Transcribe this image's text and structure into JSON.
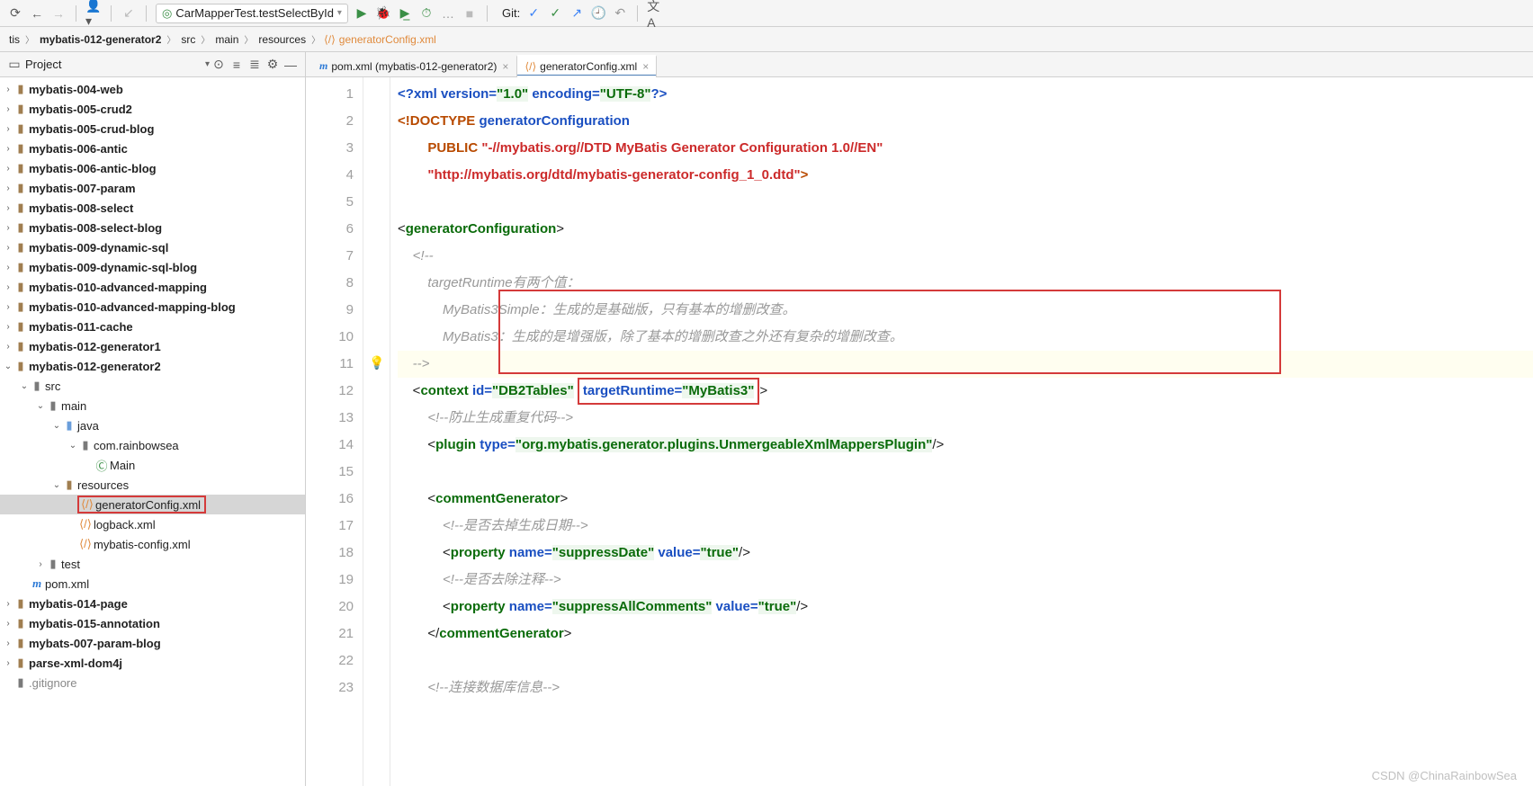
{
  "toolbar": {
    "run_config": "CarMapperTest.testSelectById",
    "git_label": "Git:"
  },
  "breadcrumb": {
    "items": [
      "tis",
      "mybatis-012-generator2",
      "src",
      "main",
      "resources"
    ],
    "file": "generatorConfig.xml"
  },
  "project": {
    "title": "Project",
    "tree": [
      {
        "d": 0,
        "c": "closed",
        "i": "folder",
        "t": "mybatis-004-web"
      },
      {
        "d": 0,
        "c": "closed",
        "i": "folder",
        "t": "mybatis-005-crud2"
      },
      {
        "d": 0,
        "c": "closed",
        "i": "folder",
        "t": "mybatis-005-crud-blog"
      },
      {
        "d": 0,
        "c": "closed",
        "i": "folder",
        "t": "mybatis-006-antic"
      },
      {
        "d": 0,
        "c": "closed",
        "i": "folder",
        "t": "mybatis-006-antic-blog"
      },
      {
        "d": 0,
        "c": "closed",
        "i": "folder",
        "t": "mybatis-007-param"
      },
      {
        "d": 0,
        "c": "closed",
        "i": "folder",
        "t": "mybatis-008-select"
      },
      {
        "d": 0,
        "c": "closed",
        "i": "folder",
        "t": "mybatis-008-select-blog"
      },
      {
        "d": 0,
        "c": "closed",
        "i": "folder",
        "t": "mybatis-009-dynamic-sql"
      },
      {
        "d": 0,
        "c": "closed",
        "i": "folder",
        "t": "mybatis-009-dynamic-sql-blog"
      },
      {
        "d": 0,
        "c": "closed",
        "i": "folder",
        "t": "mybatis-010-advanced-mapping"
      },
      {
        "d": 0,
        "c": "closed",
        "i": "folder",
        "t": "mybatis-010-advanced-mapping-blog"
      },
      {
        "d": 0,
        "c": "closed",
        "i": "folder",
        "t": "mybatis-011-cache"
      },
      {
        "d": 0,
        "c": "closed",
        "i": "folder",
        "t": "mybatis-012-generator1"
      },
      {
        "d": 0,
        "c": "open",
        "i": "folder",
        "t": "mybatis-012-generator2"
      },
      {
        "d": 1,
        "c": "open",
        "i": "folder-dark",
        "t": "src",
        "norm": true
      },
      {
        "d": 2,
        "c": "open",
        "i": "folder-dark",
        "t": "main",
        "norm": true
      },
      {
        "d": 3,
        "c": "open",
        "i": "folder-blue",
        "t": "java",
        "norm": true
      },
      {
        "d": 4,
        "c": "open",
        "i": "folder-dark",
        "t": "com.rainbowsea",
        "norm": true
      },
      {
        "d": 5,
        "c": "none",
        "i": "class",
        "t": "Main",
        "norm": true
      },
      {
        "d": 3,
        "c": "open",
        "i": "folder",
        "t": "resources",
        "norm": true
      },
      {
        "d": 4,
        "c": "none",
        "i": "xml",
        "t": "generatorConfig.xml",
        "norm": true,
        "sel": true,
        "box": true
      },
      {
        "d": 4,
        "c": "none",
        "i": "xml",
        "t": "logback.xml",
        "norm": true
      },
      {
        "d": 4,
        "c": "none",
        "i": "xml",
        "t": "mybatis-config.xml",
        "norm": true
      },
      {
        "d": 2,
        "c": "closed",
        "i": "folder-dark",
        "t": "test",
        "norm": true
      },
      {
        "d": 1,
        "c": "none",
        "i": "maven",
        "t": "pom.xml",
        "norm": true
      },
      {
        "d": 0,
        "c": "closed",
        "i": "folder",
        "t": "mybatis-014-page"
      },
      {
        "d": 0,
        "c": "closed",
        "i": "folder",
        "t": "mybatis-015-annotation"
      },
      {
        "d": 0,
        "c": "closed",
        "i": "folder",
        "t": "mybats-007-param-blog"
      },
      {
        "d": 0,
        "c": "closed",
        "i": "folder",
        "t": "parse-xml-dom4j"
      },
      {
        "d": 0,
        "c": "none",
        "i": "folder-dark",
        "t": ".gitignore",
        "grey": true
      }
    ]
  },
  "tabs": [
    {
      "icon": "m",
      "label": "pom.xml (mybatis-012-generator2)",
      "active": false
    },
    {
      "icon": "x",
      "label": "generatorConfig.xml",
      "active": true
    }
  ],
  "code": {
    "line_start": 1,
    "line_end": 23,
    "xml_decl": {
      "version": "1.0",
      "encoding": "UTF-8"
    },
    "doctype": {
      "root": "generatorConfiguration",
      "public": "-//mybatis.org//DTD MyBatis Generator Configuration 1.0//EN",
      "system": "http://mybatis.org/dtd/mybatis-generator-config_1_0.dtd"
    },
    "comment_targetRuntime": [
      "targetRuntime有两个值：",
      "MyBatis3Simple：生成的是基础版，只有基本的增删改查。",
      "MyBatis3：生成的是增强版，除了基本的增删改查之外还有复杂的增删改查。"
    ],
    "context": {
      "id": "DB2Tables",
      "targetRuntime": "MyBatis3"
    },
    "comment_dup": "防止生成重复代码",
    "plugin_type": "org.mybatis.generator.plugins.UnmergeableXmlMappersPlugin",
    "commentGen": {
      "c1": "是否去掉生成日期",
      "p1": {
        "name": "suppressDate",
        "value": "true"
      },
      "c2": "是否去除注释",
      "p2": {
        "name": "suppressAllComments",
        "value": "true"
      }
    },
    "comment_db": "连接数据库信息"
  },
  "watermark": "CSDN @ChinaRainbowSea"
}
